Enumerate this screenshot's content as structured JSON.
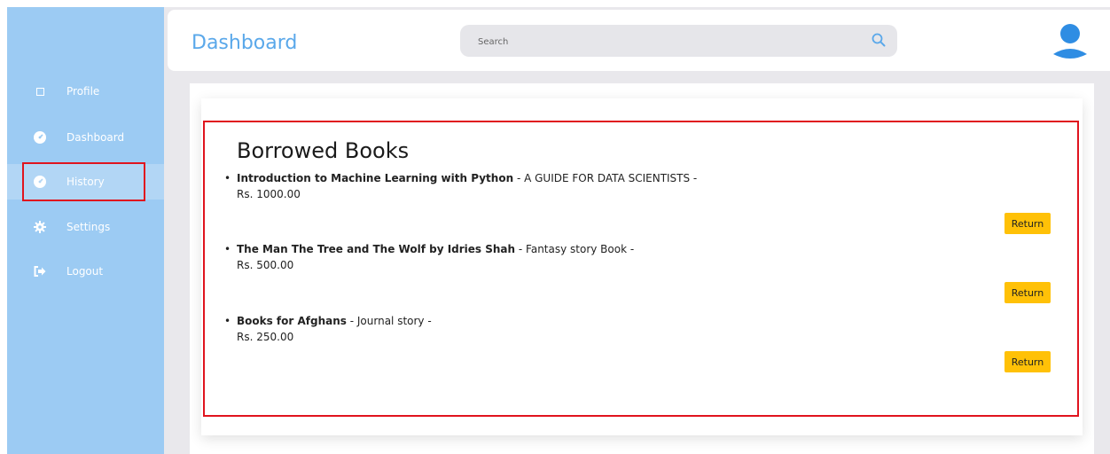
{
  "sidebar": {
    "items": [
      {
        "label": "Profile",
        "icon": "square-icon"
      },
      {
        "label": "Dashboard",
        "icon": "dashboard-gauge-icon"
      },
      {
        "label": "History",
        "icon": "dashboard-gauge-icon"
      },
      {
        "label": "Settings",
        "icon": "gear-icon"
      },
      {
        "label": "Logout",
        "icon": "sign-out-icon"
      }
    ],
    "active": "History"
  },
  "header": {
    "title": "Dashboard",
    "search_placeholder": "Search"
  },
  "borrowed": {
    "title": "Borrowed Books",
    "books": [
      {
        "name": "Introduction to Machine Learning with Python",
        "description": " - A GUIDE FOR DATA SCIENTISTS -",
        "price": "Rs. 1000.00",
        "button": "Return"
      },
      {
        "name": "The Man The Tree and The Wolf by Idries Shah",
        "description": " - Fantasy story Book -",
        "price": "Rs. 500.00",
        "button": "Return"
      },
      {
        "name": "Books for Afghans",
        "description": " - Journal story -",
        "price": "Rs. 250.00",
        "button": "Return"
      }
    ]
  },
  "colors": {
    "sidebar": "#9ccbf3",
    "accent": "#5aa8ea",
    "highlight": "#e0141e",
    "button": "#ffc107"
  }
}
